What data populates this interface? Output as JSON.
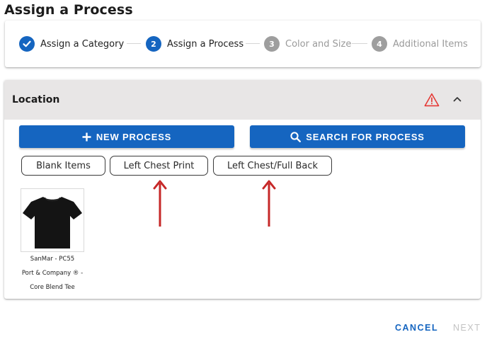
{
  "page": {
    "title": "Assign a Process"
  },
  "stepper": {
    "steps": [
      {
        "number": "",
        "label": "Assign a Category",
        "state": "done",
        "icon": "check-icon"
      },
      {
        "number": "2",
        "label": "Assign a Process",
        "state": "active"
      },
      {
        "number": "3",
        "label": "Color and Size",
        "state": "todo"
      },
      {
        "number": "4",
        "label": "Additional Items",
        "state": "todo"
      }
    ]
  },
  "location": {
    "title": "Location",
    "warning_icon": "warning-triangle-icon",
    "collapse_icon": "chevron-up-icon",
    "new_process_label": "NEW PROCESS",
    "search_process_label": "SEARCH FOR PROCESS",
    "processes": [
      "Blank Items",
      "Left Chest Print",
      "Left Chest/Full Back"
    ],
    "product": {
      "image_icon": "black-tshirt-image",
      "lines": [
        "SanMar - PC55",
        "Port & Company ® -",
        "Core Blend Tee"
      ]
    }
  },
  "footer": {
    "cancel_label": "CANCEL",
    "next_label": "NEXT"
  },
  "colors": {
    "primary": "#1565c0",
    "inactive_step": "#9e9e9e",
    "warning": "#e53935",
    "annotation_arrow": "#c62828"
  }
}
